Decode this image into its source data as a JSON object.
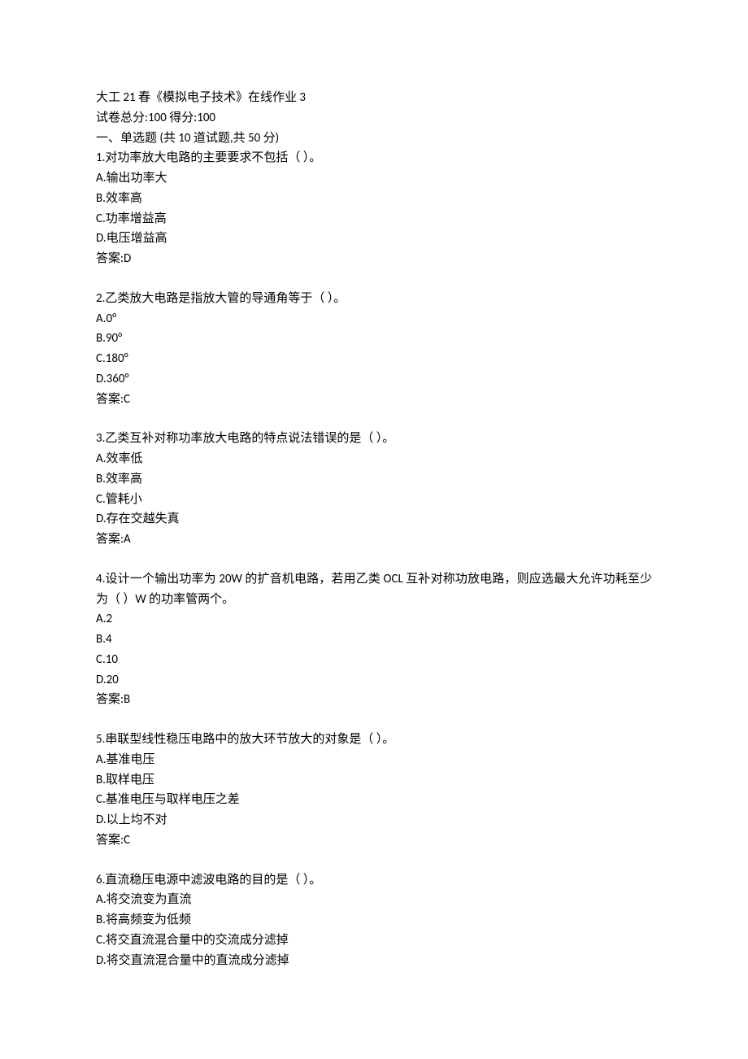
{
  "header": {
    "title": "大工 21 春《模拟电子技术》在线作业 3",
    "scoreLine": "试卷总分:100    得分:100",
    "sectionTitle": "一、单选题  (共  10  道试题,共  50  分)"
  },
  "questions": [
    {
      "stem": "1.对功率放大电路的主要要求不包括（      ）。",
      "options": [
        "A.输出功率大",
        "B.效率高",
        "C.功率增益高",
        "D.电压增益高"
      ],
      "answer": "答案:D"
    },
    {
      "stem": "2.乙类放大电路是指放大管的导通角等于（      ）。",
      "options": [
        "A.0°",
        "B.90°",
        "C.180°",
        "D.360°"
      ],
      "answer": "答案:C"
    },
    {
      "stem": "3.乙类互补对称功率放大电路的特点说法错误的是（      ）。",
      "options": [
        "A.效率低",
        "B.效率高",
        "C.管耗小",
        "D.存在交越失真"
      ],
      "answer": "答案:A"
    },
    {
      "stem": "4.设计一个输出功率为 20W 的扩音机电路，若用乙类 OCL 互补对称功放电路，则应选最大允许功耗至少为（      ）W 的功率管两个。",
      "options": [
        "A.2",
        "B.4",
        "C.10",
        "D.20"
      ],
      "answer": "答案:B"
    },
    {
      "stem": "5.串联型线性稳压电路中的放大环节放大的对象是（      ）。",
      "options": [
        "A.基准电压",
        "B.取样电压",
        "C.基准电压与取样电压之差",
        "D.以上均不对"
      ],
      "answer": "答案:C"
    },
    {
      "stem": "6.直流稳压电源中滤波电路的目的是（      ）。",
      "options": [
        "A.将交流变为直流",
        "B.将高频变为低频",
        "C.将交直流混合量中的交流成分滤掉",
        "D.将交直流混合量中的直流成分滤掉"
      ],
      "answer": ""
    }
  ]
}
